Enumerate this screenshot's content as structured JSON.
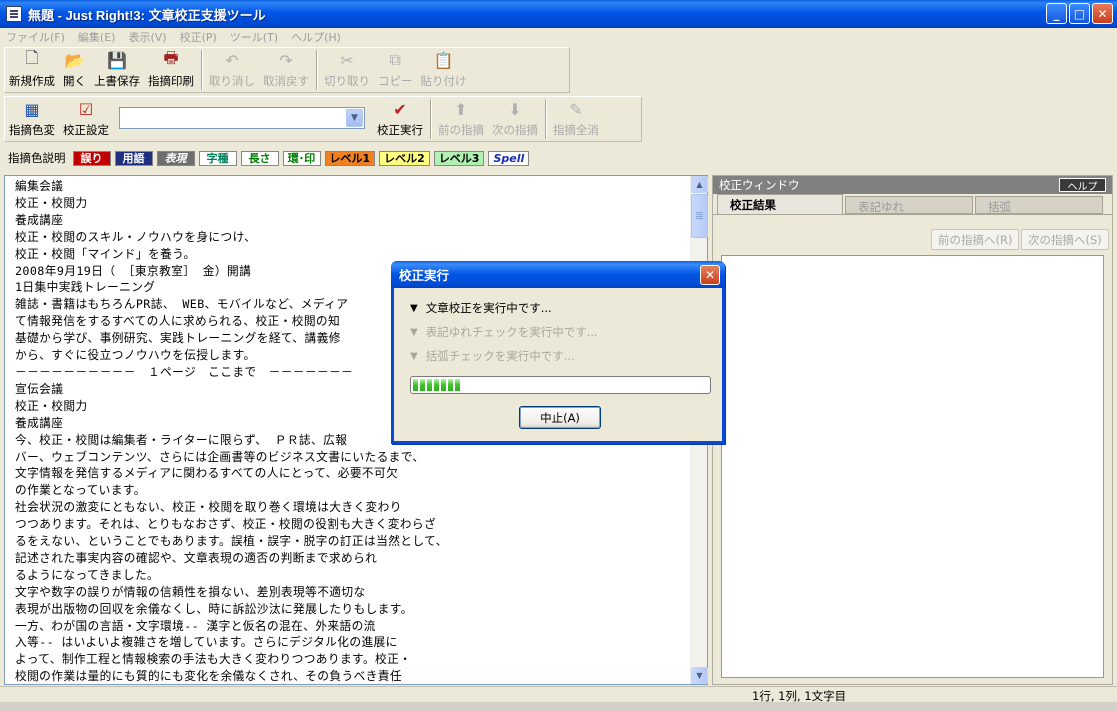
{
  "window": {
    "title": "無題 - Just Right!3: 文章校正支援ツール",
    "controls": {
      "minimize": "_",
      "maximize": "□",
      "close": "✕"
    }
  },
  "menu": [
    "ファイル(F)",
    "編集(E)",
    "表示(V)",
    "校正(P)",
    "ツール(T)",
    "ヘルプ(H)"
  ],
  "toolbar1": [
    {
      "label": "新規作成",
      "icon": "new-document-icon",
      "glyph": "🗋",
      "enabled": true
    },
    {
      "label": "開く",
      "icon": "open-folder-icon",
      "glyph": "📂",
      "enabled": true
    },
    {
      "label": "上書保存",
      "icon": "save-icon",
      "glyph": "💾",
      "enabled": true
    },
    {
      "label": "指摘印刷",
      "icon": "print-icon",
      "glyph": "🖶",
      "enabled": true
    },
    {
      "label": "取り消し",
      "icon": "undo-icon",
      "glyph": "↶",
      "enabled": false
    },
    {
      "label": "取消戻す",
      "icon": "redo-icon",
      "glyph": "↷",
      "enabled": false
    },
    {
      "label": "切り取り",
      "icon": "cut-icon",
      "glyph": "✂",
      "enabled": false
    },
    {
      "label": "コピー",
      "icon": "copy-icon",
      "glyph": "⧉",
      "enabled": false
    },
    {
      "label": "貼り付け",
      "icon": "paste-icon",
      "glyph": "📋",
      "enabled": false
    }
  ],
  "toolbar2": {
    "color_change": {
      "label": "指摘色変",
      "icon": "color-change-icon",
      "glyph": "▦"
    },
    "settings": {
      "label": "校正設定",
      "icon": "proofread-settings-icon",
      "glyph": "☑"
    },
    "combo_value": "",
    "run": {
      "label": "校正実行",
      "icon": "proofread-run-icon",
      "glyph": "✔"
    },
    "prev": {
      "label": "前の指摘",
      "icon": "arrow-up-icon",
      "glyph": "⬆"
    },
    "next": {
      "label": "次の指摘",
      "icon": "arrow-down-icon",
      "glyph": "⬇"
    },
    "clear": {
      "label": "指摘全消",
      "icon": "clear-all-icon",
      "glyph": "✎"
    }
  },
  "legend": {
    "label": "指摘色説明",
    "chips": [
      {
        "text": "誤り",
        "bg": "#c00000",
        "fg": "#ffffff"
      },
      {
        "text": "用語",
        "bg": "#1f2f7f",
        "fg": "#ffffff"
      },
      {
        "text": "表現",
        "bg": "#6e6e6e",
        "fg": "#ffffff",
        "italic": true
      },
      {
        "text": "字種",
        "bg": "#ffffff",
        "fg": "#00805a"
      },
      {
        "text": "長さ",
        "bg": "#ffffff",
        "fg": "#008000"
      },
      {
        "text": "環･印",
        "bg": "#ffffff",
        "fg": "#008000"
      },
      {
        "text": "レベル1",
        "bg": "#f08020",
        "fg": "#000000"
      },
      {
        "text": "レベル2",
        "bg": "#ffff80",
        "fg": "#000000"
      },
      {
        "text": "レベル3",
        "bg": "#b0f0b0",
        "fg": "#000000"
      },
      {
        "text": "Spell",
        "bg": "#ffffff",
        "fg": "#1a2fb0",
        "italic": true
      }
    ]
  },
  "document_lines": [
    "編集会議",
    "校正・校閲力",
    "養成講座",
    "校正・校閲のスキル・ノウハウを身につけ、",
    "校正・校閲「マインド」を養う。",
    "2008年9月19日（ ［東京教室］ 金）開講",
    "1日集中実践トレーニング",
    "雑誌・書籍はもちろんPR誌、 WEB、モバイルなど、メディア",
    "て情報発信をするすべての人に求められる、校正・校閲の知",
    "基礎から学び、事例研究、実践トレーニングを経て、講義修",
    "から、すぐに役立つノウハウを伝授します。",
    "－－－－－－－－－－　１ページ　ここまで　－－－－－－－",
    "宣伝会議",
    "校正・校閲力",
    "養成講座",
    "今、校正・校閲は編集者・ライターに限らず、 ＰＲ誌、広報",
    "バー、ウェブコンテンツ、さらには企画書等のビジネス文書にいたるまで、",
    "文字情報を発信するメディアに関わるすべての人にとって、必要不可欠",
    "の作業となっています。",
    "社会状況の激変にともない、校正・校閲を取り巻く環境は大きく変わり",
    "つつあります。それは、とりもなおさず、校正・校閲の役割も大きく変わらざ",
    "るをえない、ということでもあります。誤植・誤字・脱字の訂正は当然として、",
    "記述された事実内容の確認や、文章表現の適否の判断まで求められ",
    "るようになってきました。",
    "文字や数字の誤りが情報の信頼性を損ない、差別表現等不適切な",
    "表現が出版物の回収を余儀なくし、時に訴訟沙汰に発展したりもします。",
    "一方、わが国の言語・文字環境-- 漢字と仮名の混在、外来語の流",
    "入等-- はいよいよ複雑さを増しています。さらにデジタル化の進展に",
    "よって、制作工程と情報検索の手法も大きく変わりつつあります。校正・",
    "校閲の作業は量的にも質的にも変化を余儀なくされ、その負うべき責任"
  ],
  "panel": {
    "title": "校正ウィンドウ",
    "help": "ヘルプ",
    "tabs": [
      "校正結果",
      "表記ゆれ",
      "括弧"
    ],
    "prev_button": "前の指摘へ(R)",
    "next_button": "次の指摘へ(S)"
  },
  "status": {
    "position": "1行, 1列, 1文字目"
  },
  "dialog": {
    "title": "校正実行",
    "steps": [
      {
        "text": "文章校正を実行中です...",
        "active": true
      },
      {
        "text": "表記ゆれチェックを実行中です...",
        "active": false
      },
      {
        "text": "括弧チェックを実行中です...",
        "active": false
      }
    ],
    "progress_fraction": 0.17,
    "cancel_button": "中止(A)",
    "close_glyph": "✕"
  }
}
